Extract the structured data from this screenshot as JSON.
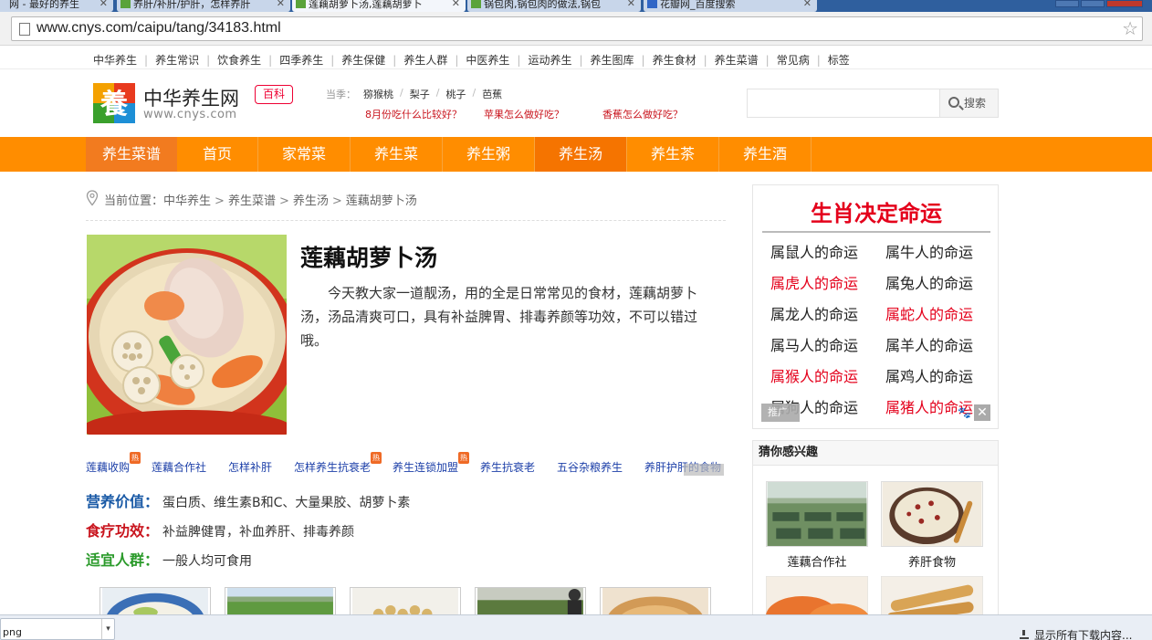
{
  "browser": {
    "tabs": [
      {
        "title": "网 - 最好的养生"
      },
      {
        "title": "养肝/补肝/护肝，怎样养肝"
      },
      {
        "title": "莲藕胡萝卜汤,莲藕胡萝卜"
      },
      {
        "title": "锅包肉,锅包肉的做法,锅包"
      },
      {
        "title": "花瓣网_百度搜索"
      }
    ],
    "url": "www.cnys.com/caipu/tang/34183.html"
  },
  "topnav": [
    "中华养生",
    "养生常识",
    "饮食养生",
    "四季养生",
    "养生保健",
    "养生人群",
    "中医养生",
    "运动养生",
    "养生图库",
    "养生食材",
    "养生菜谱",
    "常见病",
    "标签"
  ],
  "header": {
    "logo_title": "中华养生网",
    "logo_url": "www.cnys.com",
    "logo_badge": "百科",
    "season_label": "当季：",
    "season_items": [
      "猕猴桃",
      "梨子",
      "桃子",
      "芭蕉"
    ],
    "hot_questions": [
      "8月份吃什么比较好？",
      "苹果怎么做好吃？",
      "香蕉怎么做好吃？"
    ],
    "search_button": "搜索"
  },
  "mainnav": [
    "养生菜谱",
    "首页",
    "家常菜",
    "养生菜",
    "养生粥",
    "养生汤",
    "养生茶",
    "养生酒"
  ],
  "breadcrumb": {
    "label": "当前位置：",
    "items": [
      "中华养生",
      "养生菜谱",
      "养生汤",
      "莲藕胡萝卜汤"
    ]
  },
  "article": {
    "title": "莲藕胡萝卜汤",
    "intro": "今天教大家一道靓汤，用的全是日常常见的食材，莲藕胡萝卜汤，汤品清爽可口，具有补益脾胃、排毒养颜等功效，不可以错过哦。"
  },
  "ad_links": [
    {
      "text": "莲藕收购",
      "hot": true
    },
    {
      "text": "莲藕合作社",
      "hot": false
    },
    {
      "text": "怎样补肝",
      "hot": false
    },
    {
      "text": "怎样养生抗衰老",
      "hot": true
    },
    {
      "text": "养生连锁加盟",
      "hot": true
    },
    {
      "text": "养生抗衰老",
      "hot": false
    },
    {
      "text": "五谷杂粮养生",
      "hot": false
    },
    {
      "text": "养肝护肝的食物",
      "hot": false
    }
  ],
  "ad_hot_badge": "热",
  "info": [
    {
      "key": "营养价值：",
      "value": "蛋白质、维生素B和C、大量果胶、胡萝卜素",
      "color": "#1a5aa6"
    },
    {
      "key": "食疗功效：",
      "value": "补益脾健胃，补血养肝、排毒养颜",
      "color": "#c9151e"
    },
    {
      "key": "适宜人群：",
      "value": "一般人均可食用",
      "color": "#2a9a2a"
    }
  ],
  "zodiac": {
    "title": "生肖决定命运",
    "links": [
      {
        "text": "属鼠人的命运",
        "red": false
      },
      {
        "text": "属牛人的命运",
        "red": false
      },
      {
        "text": "属虎人的命运",
        "red": true
      },
      {
        "text": "属兔人的命运",
        "red": false
      },
      {
        "text": "属龙人的命运",
        "red": false
      },
      {
        "text": "属蛇人的命运",
        "red": true
      },
      {
        "text": "属马人的命运",
        "red": false
      },
      {
        "text": "属羊人的命运",
        "red": false
      },
      {
        "text": "属猴人的命运",
        "red": true
      },
      {
        "text": "属鸡人的命运",
        "red": false
      },
      {
        "text": "属狗人的命运",
        "red": false
      },
      {
        "text": "属猪人的命运",
        "red": true
      }
    ],
    "ad_tag": "推广",
    "close": "✕"
  },
  "guess": {
    "title": "猜你感兴趣",
    "items": [
      "莲藕合作社",
      "养肝食物"
    ]
  },
  "downloads": {
    "item_name": "png",
    "show_all": "显示所有下载内容..."
  },
  "colors": {
    "accent_orange": "#ff8d00",
    "red": "#e4001b",
    "link_blue": "#1c3fa8"
  }
}
